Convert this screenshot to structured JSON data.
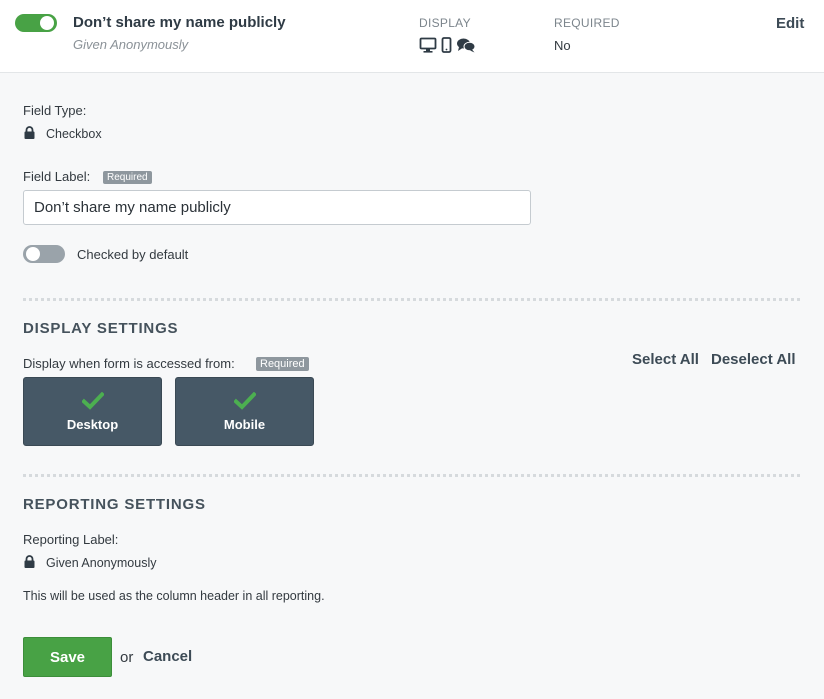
{
  "header": {
    "field_name": "Don’t share my name publicly",
    "subtitle": "Given Anonymously",
    "display_caption": "DISPLAY",
    "required_caption": "REQUIRED",
    "required_value": "No",
    "edit_label": "Edit",
    "toggle_on": true,
    "display_icons": [
      "desktop-icon",
      "mobile-icon",
      "chat-icon"
    ]
  },
  "field_type": {
    "label": "Field Type:",
    "value": "Checkbox",
    "icon": "lock-icon"
  },
  "field_label": {
    "label": "Field Label:",
    "badge": "Required",
    "value": "Don’t share my name publicly"
  },
  "checked_default": {
    "label": "Checked by default",
    "on": false
  },
  "display_settings": {
    "title": "DISPLAY SETTINGS",
    "prompt": "Display when form is accessed from:",
    "badge": "Required",
    "select_all": "Select All",
    "deselect_all": "Deselect All",
    "options": [
      {
        "label": "Desktop",
        "checked": true
      },
      {
        "label": "Mobile",
        "checked": true
      }
    ]
  },
  "reporting_settings": {
    "title": "REPORTING SETTINGS",
    "label": "Reporting Label:",
    "value": "Given Anonymously",
    "icon": "lock-icon",
    "note": "This will be used as the column header in all reporting."
  },
  "actions": {
    "save": "Save",
    "or": "or",
    "cancel": "Cancel"
  },
  "colors": {
    "accent_green": "#48a245",
    "tile_bg": "#465866",
    "badge_bg": "#8e979e",
    "check_green": "#4caf50"
  }
}
